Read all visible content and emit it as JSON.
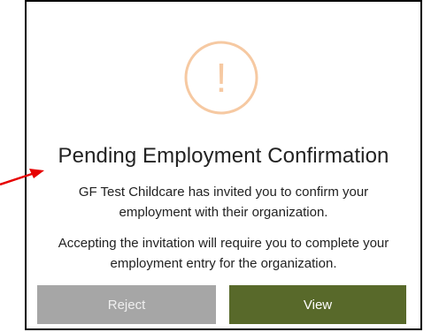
{
  "dialog": {
    "title": "Pending Employment Confirmation",
    "message_invite": "GF Test Childcare has invited you to confirm your employment with their organization.",
    "message_accept": "Accepting the invitation will require you to complete your employment entry for the organization.",
    "reject_label": "Reject",
    "view_label": "View",
    "warning_glyph": "!"
  },
  "icons": {
    "warning": "warning-circle-icon",
    "annotation": "red-arrow-icon"
  },
  "colors": {
    "warning_accent": "#f6c9a2",
    "reject_button": "#a6a6a6",
    "view_button": "#58692a",
    "annotation_arrow": "#e60000",
    "frame_border": "#000000"
  }
}
